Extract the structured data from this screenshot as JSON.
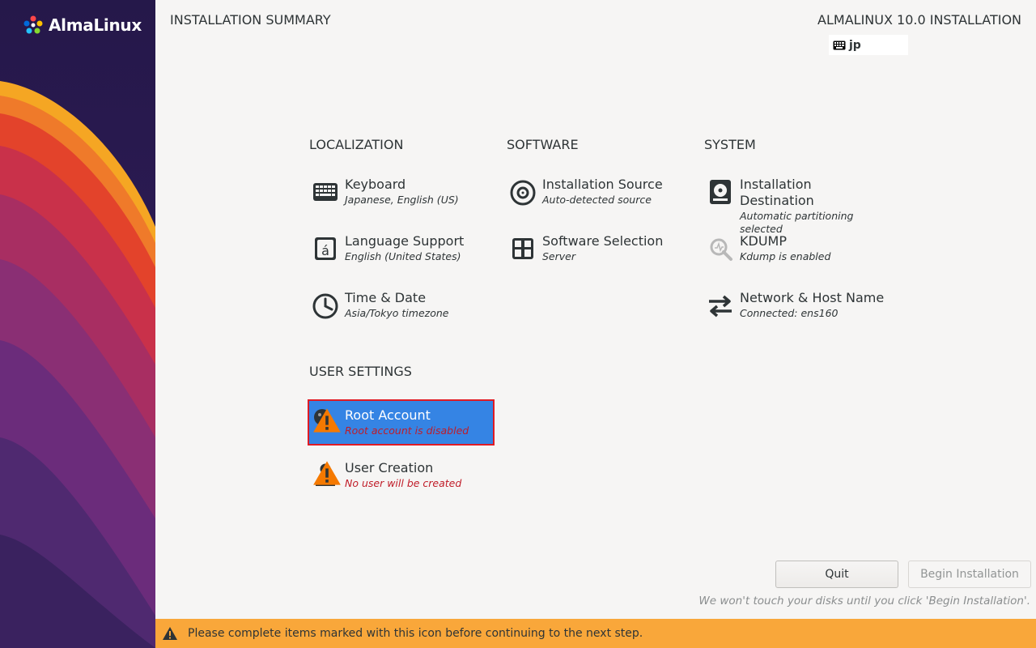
{
  "brand": {
    "name": "AlmaLinux"
  },
  "header": {
    "title": "INSTALLATION SUMMARY",
    "product": "ALMALINUX 10.0 INSTALLATION",
    "keyboard_layout": "jp"
  },
  "sections": {
    "localization": "LOCALIZATION",
    "software": "SOFTWARE",
    "system": "SYSTEM",
    "user_settings": "USER SETTINGS"
  },
  "spokes": {
    "keyboard": {
      "name": "Keyboard",
      "status": "Japanese, English (US)"
    },
    "language": {
      "name": "Language Support",
      "status": "English (United States)"
    },
    "time": {
      "name": "Time & Date",
      "status": "Asia/Tokyo timezone"
    },
    "source": {
      "name": "Installation Source",
      "status": "Auto-detected source"
    },
    "software": {
      "name": "Software Selection",
      "status": "Server"
    },
    "destination": {
      "name": "Installation Destination",
      "status": "Automatic partitioning selected"
    },
    "kdump": {
      "name": "KDUMP",
      "status": "Kdump is enabled"
    },
    "network": {
      "name": "Network & Host Name",
      "status": "Connected: ens160"
    },
    "root": {
      "name": "Root Account",
      "status": "Root account is disabled"
    },
    "user": {
      "name": "User Creation",
      "status": "No user will be created"
    }
  },
  "buttons": {
    "quit": "Quit",
    "begin": "Begin Installation"
  },
  "disk_note": "We won't touch your disks until you click 'Begin Installation'.",
  "warning": "Please complete items marked with this icon before continuing to the next step.",
  "colors": {
    "selected": "#3584e4",
    "warning_bar": "#f9a73a",
    "warning_text": "#c01c28",
    "sidebar": "#2b1a52"
  }
}
